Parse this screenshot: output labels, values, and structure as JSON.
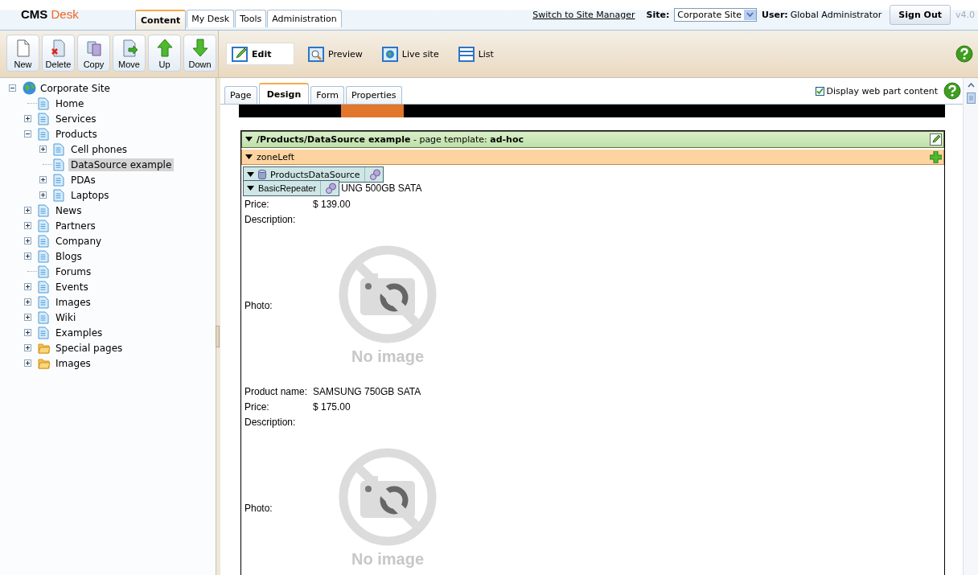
{
  "header": {
    "logo": {
      "brand": "CMS",
      "product": "Desk"
    },
    "tabs": [
      {
        "label": "Content",
        "selected": true
      },
      {
        "label": "My Desk",
        "selected": false
      },
      {
        "label": "Tools",
        "selected": false
      },
      {
        "label": "Administration",
        "selected": false
      }
    ],
    "switch_link": "Switch to Site Manager",
    "site_label": "Site:",
    "site_value": "Corporate Site",
    "user_label": "User:",
    "user_name": "Global Administrator",
    "sign_out": "Sign Out",
    "version": "v4.0"
  },
  "toolbar": {
    "actions": [
      {
        "label": "New",
        "kind": "new"
      },
      {
        "label": "Delete",
        "kind": "delete"
      },
      {
        "label": "Copy",
        "kind": "copy"
      },
      {
        "label": "Move",
        "kind": "move"
      },
      {
        "label": "Up",
        "kind": "up"
      },
      {
        "label": "Down",
        "kind": "down"
      }
    ],
    "modes": [
      {
        "label": "Edit",
        "kind": "edit",
        "selected": true
      },
      {
        "label": "Preview",
        "kind": "preview",
        "selected": false
      },
      {
        "label": "Live site",
        "kind": "live",
        "selected": false
      },
      {
        "label": "List",
        "kind": "list",
        "selected": false
      }
    ]
  },
  "tree": {
    "root": {
      "label": "Corporate Site",
      "kind": "site",
      "expanded": true,
      "selected": false,
      "children": [
        {
          "label": "Home",
          "kind": "page",
          "selected": false
        },
        {
          "label": "Services",
          "kind": "page",
          "expanded": false,
          "selected": false
        },
        {
          "label": "Products",
          "kind": "page",
          "expanded": true,
          "selected": false,
          "children": [
            {
              "label": "Cell phones",
              "kind": "page",
              "expanded": false,
              "selected": false
            },
            {
              "label": "DataSource example",
              "kind": "page",
              "selected": true
            },
            {
              "label": "PDAs",
              "kind": "page",
              "expanded": false,
              "selected": false
            },
            {
              "label": "Laptops",
              "kind": "page",
              "expanded": false,
              "selected": false
            }
          ]
        },
        {
          "label": "News",
          "kind": "page",
          "expanded": false,
          "selected": false
        },
        {
          "label": "Partners",
          "kind": "page",
          "expanded": false,
          "selected": false
        },
        {
          "label": "Company",
          "kind": "page",
          "expanded": false,
          "selected": false
        },
        {
          "label": "Blogs",
          "kind": "page",
          "expanded": false,
          "selected": false
        },
        {
          "label": "Forums",
          "kind": "page",
          "selected": false
        },
        {
          "label": "Events",
          "kind": "page",
          "expanded": false,
          "selected": false
        },
        {
          "label": "Images",
          "kind": "page",
          "expanded": false,
          "selected": false
        },
        {
          "label": "Wiki",
          "kind": "page",
          "expanded": false,
          "selected": false
        },
        {
          "label": "Examples",
          "kind": "page",
          "expanded": false,
          "selected": false
        },
        {
          "label": "Special pages",
          "kind": "folder",
          "expanded": false,
          "selected": false
        },
        {
          "label": "Images",
          "kind": "folder",
          "expanded": false,
          "selected": false
        }
      ]
    }
  },
  "editor": {
    "tabs": [
      {
        "label": "Page",
        "selected": false
      },
      {
        "label": "Design",
        "selected": true
      },
      {
        "label": "Form",
        "selected": false
      },
      {
        "label": "Properties",
        "selected": false
      }
    ],
    "display_web_part_content": {
      "label": "Display web part content",
      "checked": true
    },
    "template_bar": "**/Products/DataSource example** - page template: **ad-hoc**",
    "zone": "zoneLeft",
    "data_source": "ProductsDataSource",
    "repeater": "BasicRepeater",
    "products": [
      {
        "fields": [
          {
            "kind": "text",
            "value": "UNG 500GB SATA"
          },
          {
            "kind": "text",
            "label": "Price:",
            "value": "$ 139.00"
          },
          {
            "kind": "text",
            "label": "Description:"
          },
          {
            "kind": "photo",
            "label": "Photo:",
            "image_text": "No image"
          }
        ]
      },
      {
        "fields": [
          {
            "kind": "text",
            "label": "Product name:",
            "value": "SAMSUNG 750GB SATA"
          },
          {
            "kind": "text",
            "label": "Price:",
            "value": "$ 175.00"
          },
          {
            "kind": "text",
            "label": "Description:"
          },
          {
            "kind": "photo",
            "label": "Photo:",
            "image_text": "No image"
          }
        ]
      }
    ]
  }
}
